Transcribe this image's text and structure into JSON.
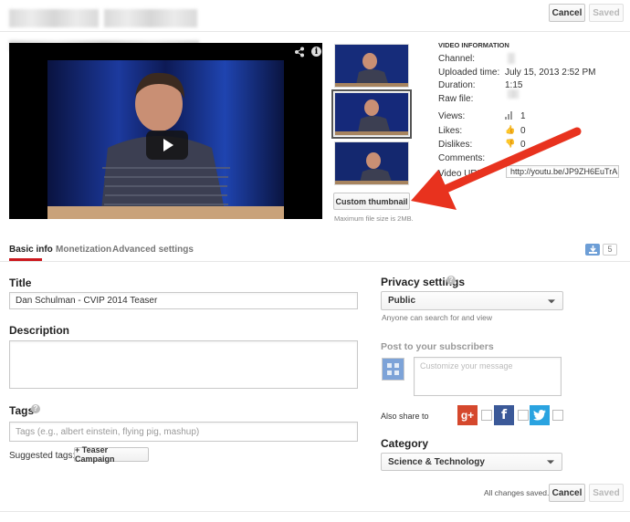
{
  "header": {
    "cancel_label": "Cancel",
    "saved_label": "Saved"
  },
  "video": {
    "play_icon": "play-icon",
    "share_icon": "share-icon",
    "info_icon": "info-icon"
  },
  "thumbnails": {
    "custom_thumbnail_label": "Custom thumbnail",
    "max_file_size": "Maximum file size is 2MB."
  },
  "video_information": {
    "heading": "VIDEO INFORMATION",
    "rows": [
      {
        "key": "Channel:",
        "value": ""
      },
      {
        "key": "Uploaded time:",
        "value": "July 15, 2013 2:52 PM"
      },
      {
        "key": "Duration:",
        "value": "1:15"
      },
      {
        "key": "Raw file:",
        "value": ""
      },
      {
        "key": "Views:",
        "value": "1"
      },
      {
        "key": "Likes:",
        "value": "0"
      },
      {
        "key": "Dislikes:",
        "value": "0"
      },
      {
        "key": "Comments:",
        "value": ""
      }
    ],
    "video_url_label": "Video URL:",
    "video_url": "http://youtu.be/JP9ZH6EuTrA"
  },
  "tabs": [
    {
      "label": "Basic info"
    },
    {
      "label": "Monetization"
    },
    {
      "label": "Advanced settings"
    }
  ],
  "tab_badge_count": "5",
  "form": {
    "title_label": "Title",
    "title_value": "Dan Schulman - CVIP 2014 Teaser",
    "description_label": "Description",
    "description_value": "",
    "tags_label": "Tags",
    "tags_placeholder": "Tags (e.g., albert einstein, flying pig, mashup)",
    "suggested_tags_label": "Suggested tags:",
    "suggested_tag": "+ Teaser Campaign"
  },
  "privacy": {
    "label": "Privacy settings",
    "selected": "Public",
    "hint": "Anyone can search for and view"
  },
  "subscribers": {
    "label": "Post to your subscribers",
    "placeholder": "Customize your message",
    "also_share_label": "Also share to"
  },
  "category": {
    "label": "Category",
    "selected": "Science & Technology"
  },
  "footer": {
    "status": "All changes saved.",
    "cancel_label": "Cancel",
    "saved_label": "Saved"
  },
  "colors": {
    "arrow": "#e8321e",
    "tab_underline": "#cc181e",
    "google_plus": "#d5482d",
    "facebook": "#3b5998",
    "twitter": "#2aa3e0",
    "link": "#1a5fa6"
  }
}
